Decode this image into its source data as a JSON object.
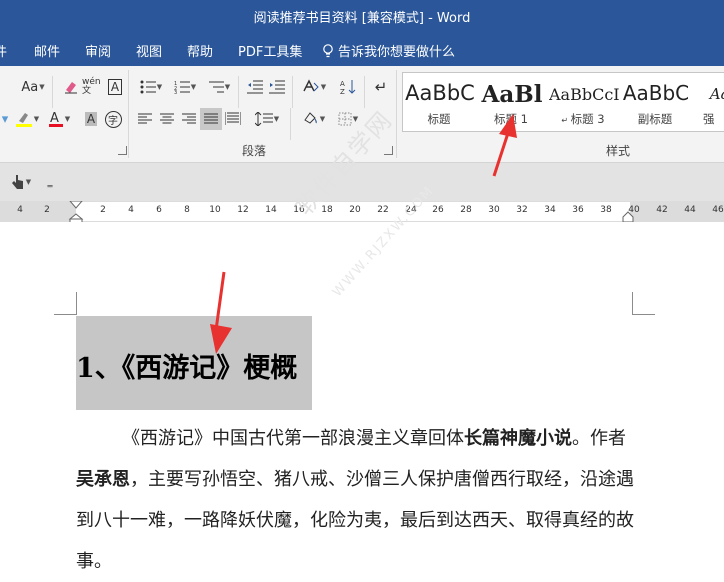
{
  "window": {
    "title": "阅读推荐书目资料 [兼容模式] - Word"
  },
  "menu": {
    "items": [
      "件",
      "邮件",
      "审阅",
      "视图",
      "帮助",
      "PDF工具集"
    ],
    "tell_me": "告诉我你想要做什么"
  },
  "ribbon": {
    "font_size_label": "Aa",
    "pinyin_label": "wén文",
    "char_border_label": "A",
    "char_shade_label": "A",
    "enclosed_char_label": "字",
    "paragraph_group": "段落",
    "styles_group": "样式",
    "styles": [
      {
        "sample": "AaBbC",
        "label": "标题"
      },
      {
        "sample": "AaBl",
        "label": "标题 1"
      },
      {
        "sample": "AaBbCcI",
        "label": "标题 3"
      },
      {
        "sample": "AaBbC",
        "label": "副标题"
      },
      {
        "sample": "AaBb",
        "label": "强"
      }
    ]
  },
  "ruler": {
    "numbers": [
      "4",
      "2",
      "2",
      "4",
      "6",
      "8",
      "10",
      "12",
      "14",
      "16",
      "18",
      "20",
      "22",
      "24",
      "26",
      "28",
      "30",
      "32",
      "34",
      "36",
      "38",
      "40",
      "42",
      "44",
      "46"
    ]
  },
  "document": {
    "heading": "1、《西游记》梗概",
    "body_runs": [
      {
        "text": "《西游记》中国古代第一部浪漫主义章回体",
        "bold": false
      },
      {
        "text": "长篇神魔小说",
        "bold": true
      },
      {
        "text": "。作者",
        "bold": false
      },
      {
        "text": "吴承恩",
        "bold": true
      },
      {
        "text": "，主要写孙悟空、猪八戒、沙僧三人保护唐僧西行取经，沿途遇到八十一难，一路降妖伏魔，化险为夷，最后到达西天、取得真经的故事。",
        "bold": false
      }
    ]
  },
  "watermark": {
    "text": "软件自学网",
    "url": "WWW.RJZXW.COM"
  },
  "colors": {
    "brand": "#2b579a",
    "highlight": "#c6c6c6",
    "arrow": "#e8322f"
  }
}
